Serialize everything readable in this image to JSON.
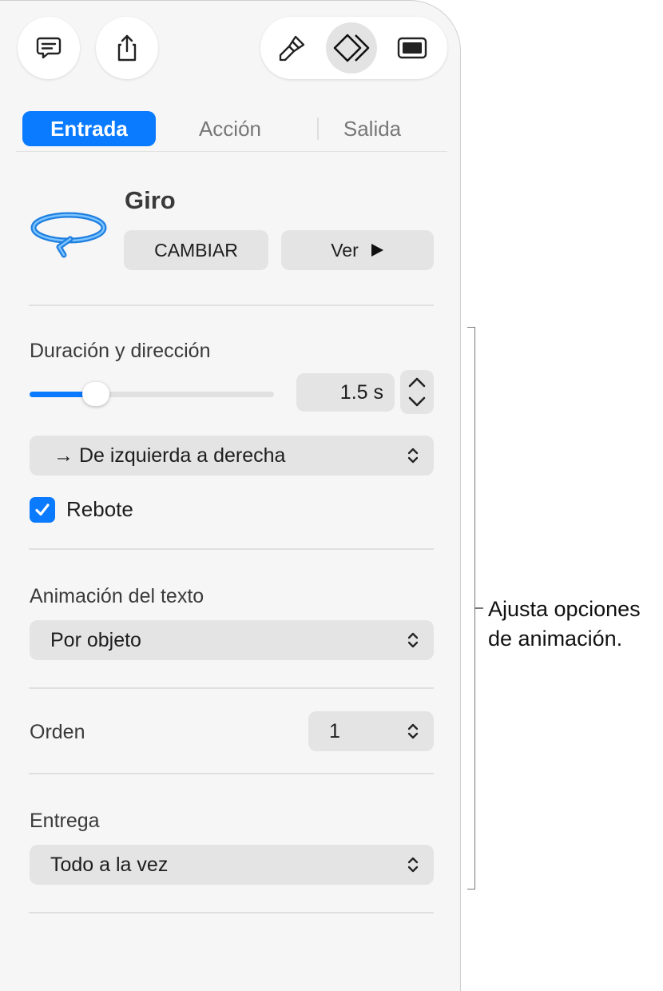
{
  "toolbar": {
    "comment_icon": "comment-bubble-icon",
    "share_icon": "share-icon",
    "format_icon": "paintbrush-icon",
    "animate_icon": "animate-diamond-icon",
    "document_icon": "document-icon",
    "active_segment": "animate"
  },
  "tabs": [
    {
      "label": "Entrada",
      "active": true
    },
    {
      "label": "Acción",
      "active": false
    },
    {
      "label": "Salida",
      "active": false
    }
  ],
  "effect": {
    "name": "Giro",
    "icon": "spin-arrow-icon",
    "change_label": "CAMBIAR",
    "preview_label": "Ver",
    "preview_icon": "play-triangle-icon"
  },
  "duration": {
    "label": "Duración y dirección",
    "value": "1.5 s",
    "slider_fraction": 0.27,
    "direction": "→ De izquierda a derecha"
  },
  "bounce": {
    "label": "Rebote",
    "checked": true
  },
  "text_animation": {
    "label": "Animación del texto",
    "value": "Por objeto"
  },
  "order": {
    "label": "Orden",
    "value": "1"
  },
  "delivery": {
    "label": "Entrega",
    "value": "Todo a la vez"
  },
  "annotation": {
    "line1": "Ajusta opciones",
    "line2": "de animación."
  },
  "colors": {
    "accent": "#0a7aff",
    "panel": "#f6f6f6",
    "control": "#e4e4e4"
  }
}
